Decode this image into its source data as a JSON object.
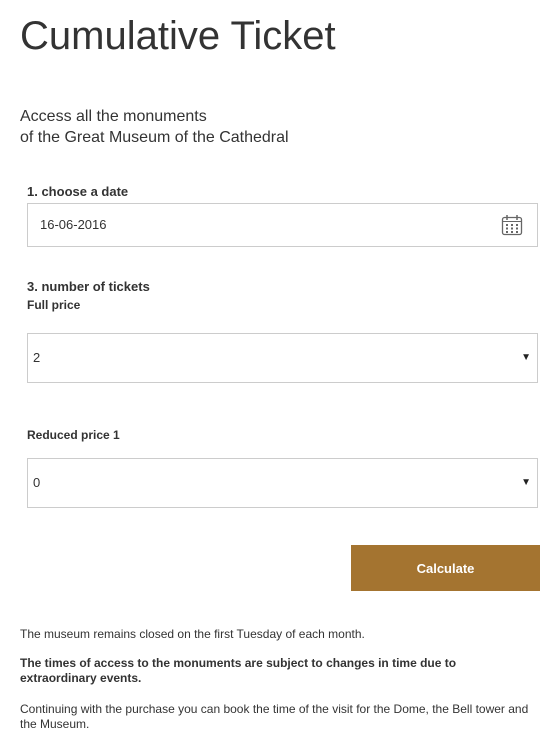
{
  "page": {
    "title": "Cumulative Ticket",
    "subtitle_line1": "Access all the monuments",
    "subtitle_line2": "of the Great Museum of the Cathedral"
  },
  "form": {
    "date_label": "1. choose a date",
    "date_value": "16-06-2016",
    "date_icon": "calendar-icon",
    "tickets_label": "3. number of tickets",
    "full_price_label": "Full price",
    "full_price_value": "2",
    "reduced_price_label": "Reduced price 1",
    "reduced_price_value": "0",
    "calculate_label": "Calculate"
  },
  "notes": {
    "closed": "The museum remains closed on the first Tuesday of each month.",
    "access_changes": "The times of access to the monuments are subject to changes in time due to extraordinary events.",
    "continuing": "Continuing with the purchase you can book the time of the visit for the Dome, the Bell tower and the Museum."
  },
  "colors": {
    "button_bg": "#a47430",
    "button_text": "#ffffff",
    "border": "#cccccc",
    "text": "#333333"
  }
}
